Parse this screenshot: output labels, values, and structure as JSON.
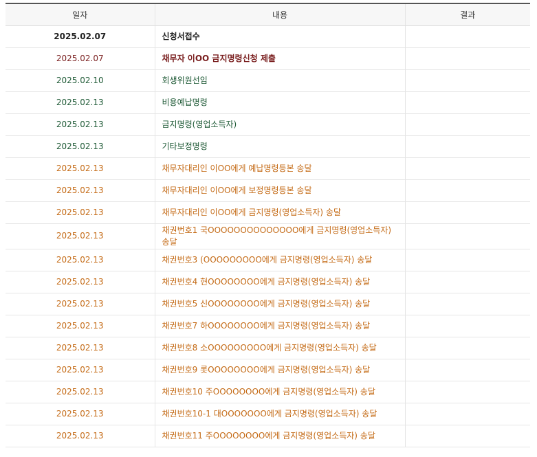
{
  "table": {
    "headers": [
      "일자",
      "내용",
      "결과"
    ],
    "rows": [
      {
        "date": "2025.02.07",
        "content": "신청서접수",
        "result": ""
      },
      {
        "date": "2025.02.07",
        "content": "채무자 이OO 금지명령신청 제출",
        "result": ""
      },
      {
        "date": "2025.02.10",
        "content": "회생위원선임",
        "result": ""
      },
      {
        "date": "2025.02.13",
        "content": "비용예납명령",
        "result": ""
      },
      {
        "date": "2025.02.13",
        "content": "금지명령(영업소득자)",
        "result": ""
      },
      {
        "date": "2025.02.13",
        "content": "기타보정명령",
        "result": ""
      },
      {
        "date": "2025.02.13",
        "content": "채무자대리인 이OO에게 예납명령등본 송달",
        "result": ""
      },
      {
        "date": "2025.02.13",
        "content": "채무자대리인 이OO에게 보정명령등본 송달",
        "result": ""
      },
      {
        "date": "2025.02.13",
        "content": "채무자대리인 이OO에게 금지명령(영업소득자) 송달",
        "result": ""
      },
      {
        "date": "2025.02.13",
        "content": "채권번호1 국OOOOOOOOOOOOOO에게 금지명령(영업소득자) 송달",
        "result": ""
      },
      {
        "date": "2025.02.13",
        "content": "채권번호3 (OOOOOOOOO에게 금지명령(영업소득자) 송달",
        "result": ""
      },
      {
        "date": "2025.02.13",
        "content": "채권번호4 현OOOOOOOO에게 금지명령(영업소득자) 송달",
        "result": ""
      },
      {
        "date": "2025.02.13",
        "content": "채권번호5 신OOOOOOOO에게 금지명령(영업소득자) 송달",
        "result": ""
      },
      {
        "date": "2025.02.13",
        "content": "채권번호7 하OOOOOOOO에게 금지명령(영업소득자) 송달",
        "result": ""
      },
      {
        "date": "2025.02.13",
        "content": "채권번호8 소OOOOOOOOO에게 금지명령(영업소득자) 송달",
        "result": ""
      },
      {
        "date": "2025.02.13",
        "content": "채권번호9 롯OOOOOOOO에게 금지명령(영업소득자) 송달",
        "result": ""
      },
      {
        "date": "2025.02.13",
        "content": "채권번호10 주OOOOOOOO에게 금지명령(영업소득자) 송달",
        "result": ""
      },
      {
        "date": "2025.02.13",
        "content": "채권번호10-1 대OOOOOOO에게 금지명령(영업소득자) 송달",
        "result": ""
      },
      {
        "date": "2025.02.13",
        "content": "채권번호11 주OOOOOOOO에게 금지명령(영업소득자) 송달",
        "result": ""
      }
    ]
  },
  "colors": {
    "bold_black": "#222222",
    "maroon": "#7a1f1f",
    "green": "#1f5a36",
    "orange": "#c46a15"
  }
}
